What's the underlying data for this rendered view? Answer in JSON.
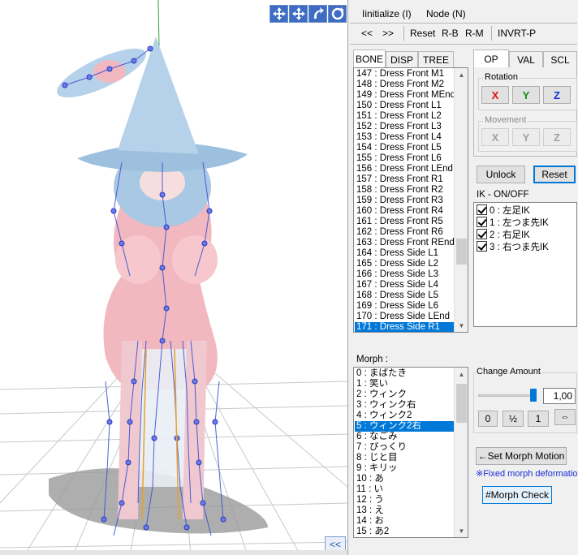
{
  "viewport": {
    "tools": [
      "move-axis-icon",
      "move-view-icon",
      "rotate-icon",
      "refresh-icon"
    ],
    "collapse_label": "<<"
  },
  "menu": {
    "initialize": "Iinitialize (I)",
    "node": "Node (N)"
  },
  "nav": {
    "prev": "<<",
    "next": ">>",
    "reset": "Reset",
    "rb": "R-B",
    "rm": "R-M",
    "invrt": "INVRT-P"
  },
  "bone_tabs": [
    "BONE",
    "DISP",
    "TREE"
  ],
  "bones": [
    "147 : Dress Front M1",
    "148 : Dress Front M2",
    "149 : Dress Front MEnd",
    "150 : Dress Front L1",
    "151 : Dress Front L2",
    "152 : Dress Front L3",
    "153 : Dress Front L4",
    "154 : Dress Front L5",
    "155 : Dress Front L6",
    "156 : Dress Front LEnd",
    "157 : Dress Front R1",
    "158 : Dress Front R2",
    "159 : Dress Front R3",
    "160 : Dress Front R4",
    "161 : Dress Front R5",
    "162 : Dress Front R6",
    "163 : Dress Front REnd",
    "164 : Dress Side L1",
    "165 : Dress Side L2",
    "166 : Dress Side L3",
    "167 : Dress Side L4",
    "168 : Dress Side L5",
    "169 : Dress Side L6",
    "170 : Dress Side LEnd",
    "171 : Dress Side R1"
  ],
  "op_tabs": [
    "OP",
    "VAL",
    "SCL"
  ],
  "rotation": {
    "label": "Rotation",
    "x": "X",
    "y": "Y",
    "z": "Z"
  },
  "movement": {
    "label": "Movement",
    "x": "X",
    "y": "Y",
    "z": "Z"
  },
  "unlock_label": "Unlock",
  "reset_label": "Reset",
  "ik": {
    "label": "IK - ON/OFF",
    "items": [
      "0 : 左足IK",
      "1 : 左つま先IK",
      "2 : 右足IK",
      "3 : 右つま先IK"
    ]
  },
  "morph": {
    "label": "Morph :",
    "items": [
      "0 : まばたき",
      "1 : 笑い",
      "2 : ウィンク",
      "3 : ウィンク右",
      "4 : ウィンク2",
      "5 : ウィンク2右",
      "6 : なごみ",
      "7 : びっくり",
      "8 : じと目",
      "9 : キリッ",
      "10 : あ",
      "11 : い",
      "12 : う",
      "13 : え",
      "14 : お",
      "15 : あ2"
    ],
    "selected_index": 5
  },
  "change_amount": {
    "label": "Change Amount",
    "value": "1,00",
    "level": 1.0,
    "btn_zero": "0",
    "btn_half": "½",
    "btn_one": "1",
    "btn_swap": "⇔"
  },
  "set_morph_motion": "←Set Morph Motion",
  "fixed_note": "※Fixed morph deformation",
  "morph_check": "#Morph Check",
  "colors": {
    "rotation_x": "#e01010",
    "rotation_y": "#109010",
    "rotation_z": "#1030d0",
    "selection": "#0078d7",
    "note": "#1a2bd6"
  }
}
